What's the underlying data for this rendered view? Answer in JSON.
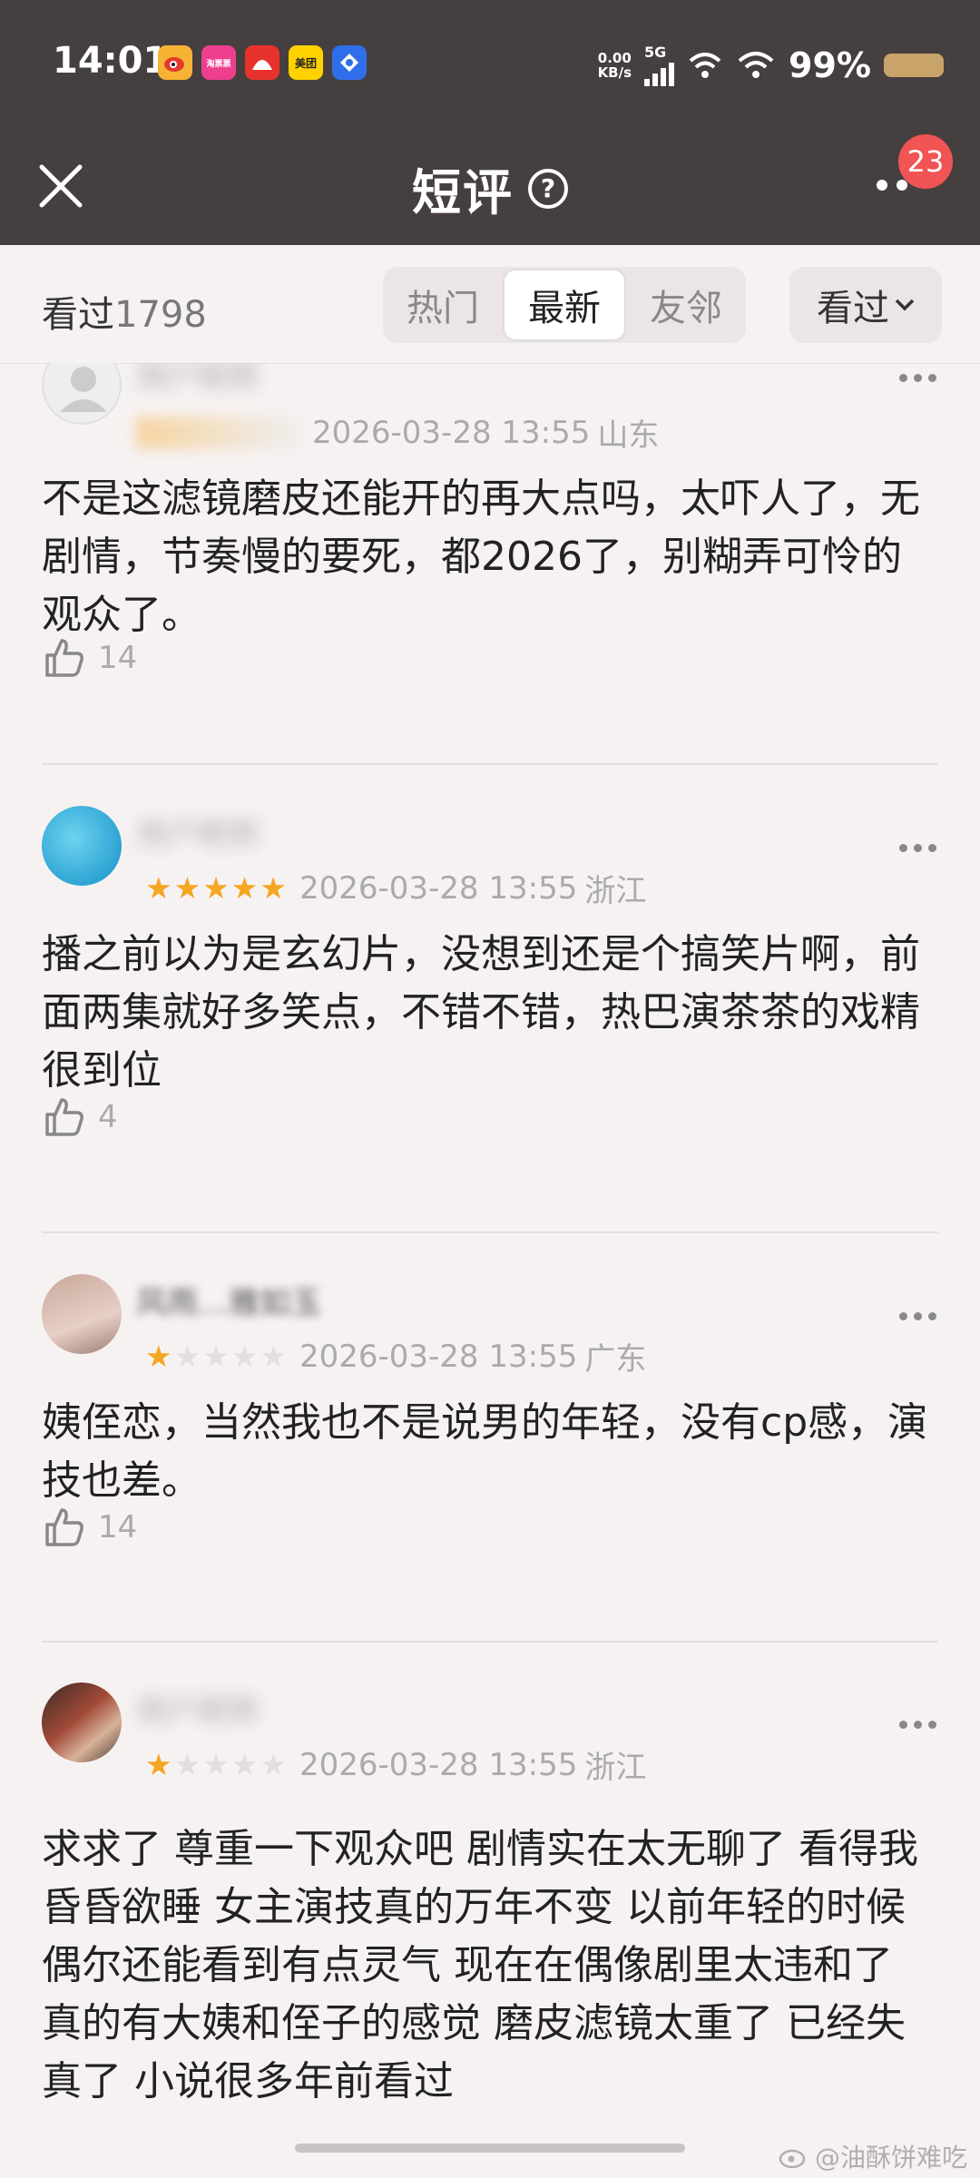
{
  "status_bar": {
    "time": "14:01",
    "net_speed_value": "0.00",
    "net_speed_unit": "KB/s",
    "network": "5G",
    "battery": "99%",
    "apps": [
      {
        "icon": "weibo-app-icon",
        "color": "#f6b334",
        "label": ""
      },
      {
        "icon": "taopiaopiao-app-icon",
        "color": "#ee3f8f",
        "label": "淘票票"
      },
      {
        "icon": "maoyan-app-icon",
        "color": "#e8332c",
        "label": ""
      },
      {
        "icon": "meituan-app-icon",
        "color": "#ffd200",
        "label": "美团"
      },
      {
        "icon": "blue-app-icon",
        "color": "#2f6ee8",
        "label": ""
      }
    ]
  },
  "header": {
    "title": "短评",
    "help": "?",
    "badge": "23"
  },
  "filter": {
    "seen_label": "看过",
    "seen_count": "1798",
    "tabs": [
      "热门",
      "最新",
      "友邻"
    ],
    "active_tab": "最新",
    "dropdown": "看过"
  },
  "reviews": [
    {
      "username": "用户昵称",
      "rating": 0,
      "date": "2026-03-28 13:55",
      "location": "山东",
      "content": "不是这滤镜磨皮还能开的再大点吗，太吓人了，无剧情，节奏慢的要死，都2026了，别糊弄可怜的观众了。",
      "likes": "14"
    },
    {
      "username": "用户昵称",
      "rating": 5,
      "date": "2026-03-28 13:55",
      "location": "浙江",
      "content": "播之前以为是玄幻片，没想到还是个搞笑片啊，前面两集就好多笑点，不错不错，热巴演茶茶的戏精很到位",
      "likes": "4"
    },
    {
      "username": "风雨…雅如玉",
      "rating": 1,
      "date": "2026-03-28 13:55",
      "location": "广东",
      "content": "姨侄恋，当然我也不是说男的年轻，没有cp感，演技也差。",
      "likes": "14"
    },
    {
      "username": "用户昵称",
      "rating": 1,
      "date": "2026-03-28 13:55",
      "location": "浙江",
      "content": "求求了 尊重一下观众吧 剧情实在太无聊了 看得我昏昏欲睡 女主演技真的万年不变 以前年轻的时候偶尔还能看到有点灵气 现在在偶像剧里太违和了 真的有大姨和侄子的感觉 磨皮滤镜太重了 已经失真了 小说很多年前看过",
      "likes": ""
    }
  ],
  "watermark": "@油酥饼难吃"
}
